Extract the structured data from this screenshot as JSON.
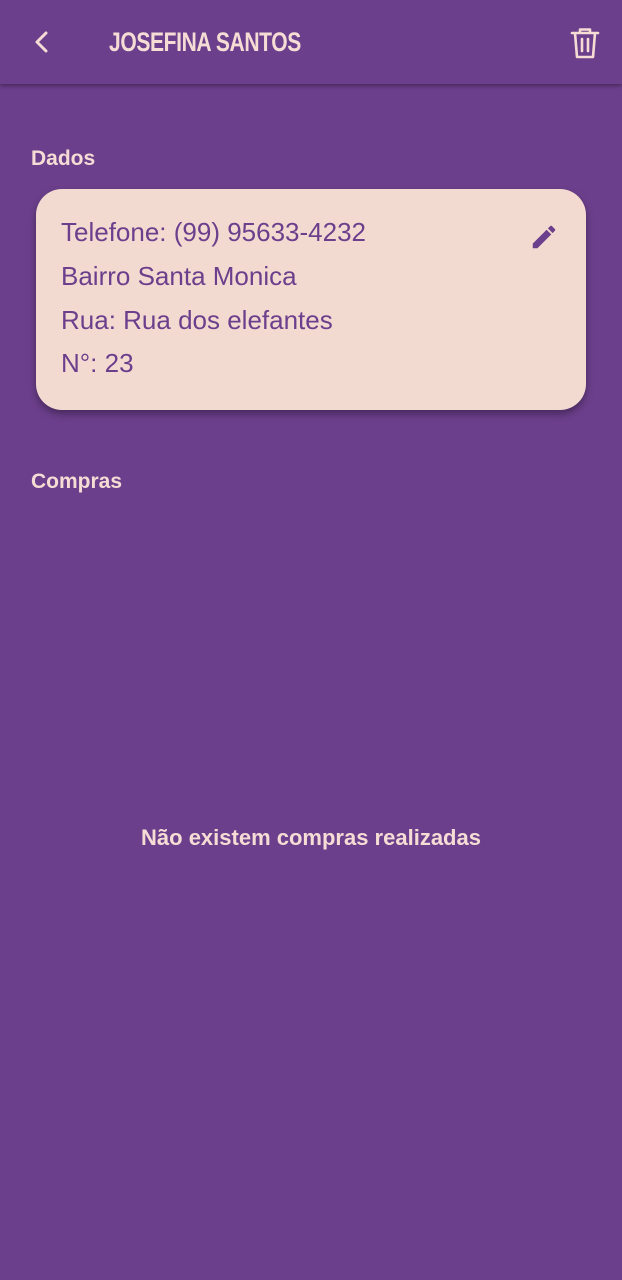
{
  "header": {
    "title": "JOSEFINA SANTOS",
    "back_icon": "chevron-left-icon",
    "delete_icon": "trash-icon"
  },
  "sections": {
    "dados_label": "Dados",
    "compras_label": "Compras"
  },
  "contact": {
    "telefone": "Telefone: (99) 95633-4232",
    "bairro": "Bairro Santa Monica",
    "rua": "Rua: Rua dos elefantes",
    "numero": "N°: 23",
    "edit_icon": "pencil-icon"
  },
  "purchases": {
    "empty_message": "Não existem compras realizadas"
  },
  "colors": {
    "background": "#6c3f8c",
    "card": "#f3dad1",
    "accent_text": "#f5dcd5"
  }
}
